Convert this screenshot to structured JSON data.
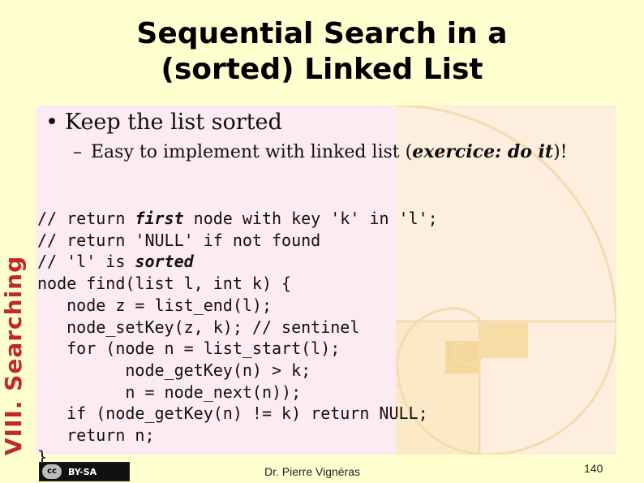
{
  "slide": {
    "title_line1": "Sequential Search in a",
    "title_line2": "(sorted) Linked List",
    "section": "VIII. Searching",
    "bullet": "Keep the list sorted",
    "bullet_dot": "•",
    "subbullet_dash": "–",
    "subbullet_pre": "Easy to implement with linked list (",
    "subbullet_em": "exercice: do it",
    "subbullet_post": ")!",
    "code": {
      "l1_a": "// return ",
      "l1_kw": "first",
      "l1_b": " node with key 'k' in 'l';",
      "l2": "// return 'NULL' if not found",
      "l3_a": "// 'l' is ",
      "l3_kw": "sorted",
      "l4": "node find(list l, int k) {",
      "l5": "   node z = list_end(l);",
      "l6": "   node_setKey(z, k); // sentinel",
      "l7": "   for (node n = list_start(l);",
      "l8": "         node_getKey(n) > k;",
      "l9": "         n = node_next(n));",
      "l10": "   if (node_getKey(n) != k) return NULL;",
      "l11": "   return n;",
      "l12": "}"
    },
    "license_cc": "cc",
    "license_label": "BY-SA",
    "author": "Dr. Pierre Vignéras",
    "page_number": "140"
  }
}
